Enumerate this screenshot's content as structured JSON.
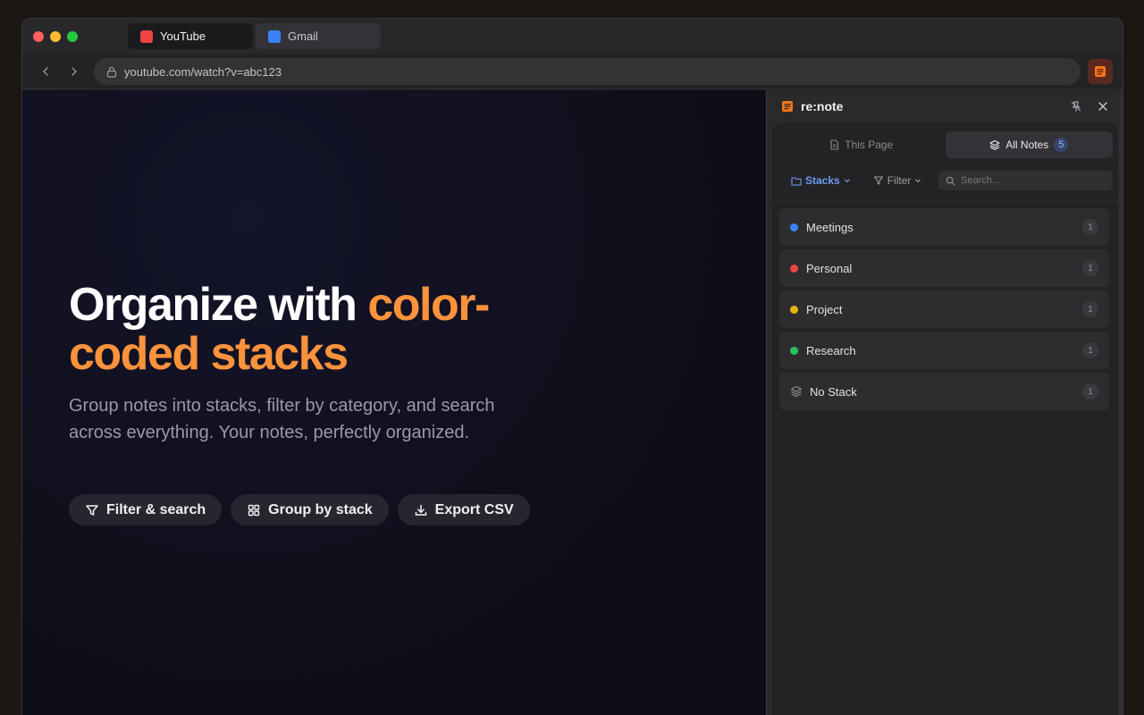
{
  "browser": {
    "tabs": [
      {
        "label": "YouTube",
        "favicon_color": "#ef4444",
        "active": true
      },
      {
        "label": "Gmail",
        "favicon_color": "#3b82f6",
        "active": false
      }
    ],
    "url": "youtube.com/watch?v=abc123"
  },
  "hero": {
    "title_part1": "Organize with ",
    "title_accent": "color-coded stacks",
    "subtitle": "Group notes into stacks, filter by category, and search across everything. Your notes, perfectly organized.",
    "chips": [
      {
        "label": "Filter & search",
        "icon": "filter-icon"
      },
      {
        "label": "Group by stack",
        "icon": "grid-icon"
      },
      {
        "label": "Export CSV",
        "icon": "download-icon"
      }
    ],
    "accent_color": "#fb923c"
  },
  "panel": {
    "title": "re:note",
    "tabs": {
      "this_page": "This Page",
      "all_notes": "All Notes",
      "all_notes_count": "5"
    },
    "toolbar": {
      "stacks_label": "Stacks",
      "filter_label": "Filter",
      "search_placeholder": "Search..."
    },
    "stacks": [
      {
        "label": "Meetings",
        "color": "#3b82f6",
        "count": "1"
      },
      {
        "label": "Personal",
        "color": "#ef4444",
        "count": "1"
      },
      {
        "label": "Project",
        "color": "#eab308",
        "count": "1"
      },
      {
        "label": "Research",
        "color": "#22c55e",
        "count": "1"
      },
      {
        "label": "No Stack",
        "color": "",
        "count": "1",
        "icon": "layers-icon"
      }
    ]
  }
}
